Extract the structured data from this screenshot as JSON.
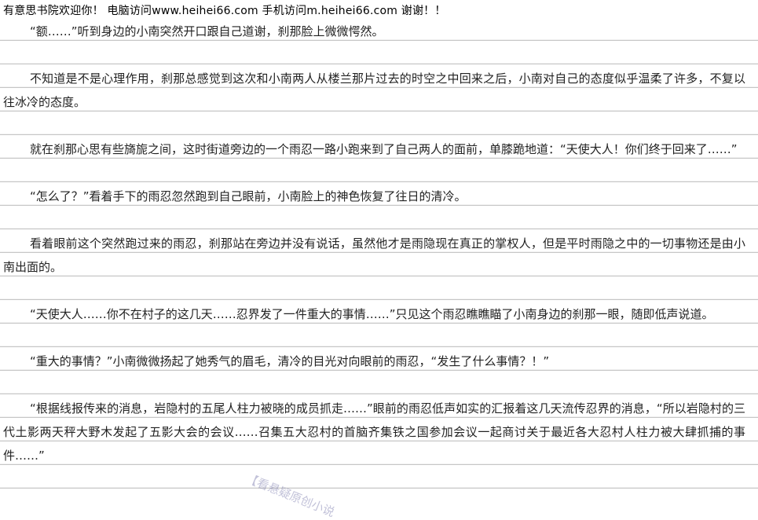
{
  "banner": {
    "text": "有意思书院欢迎你！ 电脑访问www.heihei66.com 手机访问m.heihei66.com 谢谢！！"
  },
  "paragraphs": [
    "“额……”听到身边的小南突然开口跟自己道谢，刹那脸上微微愕然。",
    "不知道是不是心理作用，刹那总感觉到这次和小南两人从楼兰那片过去的时空之中回来之后，小南对自己的态度似乎温柔了许多，不复以往冰冷的态度。",
    "就在刹那心思有些旖旎之间，这时街道旁边的一个雨忍一路小跑来到了自己两人的面前，单膝跪地道：“天使大人！你们终于回来了……”",
    "“怎么了？”看着手下的雨忍忽然跑到自己眼前，小南脸上的神色恢复了往日的清冷。",
    "看着眼前这个突然跑过来的雨忍，刹那站在旁边并没有说话，虽然他才是雨隐现在真正的掌权人，但是平时雨隐之中的一切事物还是由小南出面的。",
    "“天使大人……你不在村子的这几天……忍界发了一件重大的事情……”只见这个雨忍瞧瞧瞄了小南身边的刹那一眼，随即低声说道。",
    "“重大的事情？”小南微微扬起了她秀气的眉毛，清冷的目光对向眼前的雨忍，“发生了什么事情？！”",
    "“根据线报传来的消息，岩隐村的五尾人柱力被晓的成员抓走……”眼前的雨忍低声如实的汇报着这几天流传忍界的消息，“所以岩隐村的三代土影两天秤大野木发起了五影大会的会议……召集五大忍村的首脑齐集铁之国参加会议一起商讨关于最近各大忍村人柱力被大肆抓捕的事件……”"
  ],
  "watermark": {
    "text": "【看悬疑原创小说"
  }
}
